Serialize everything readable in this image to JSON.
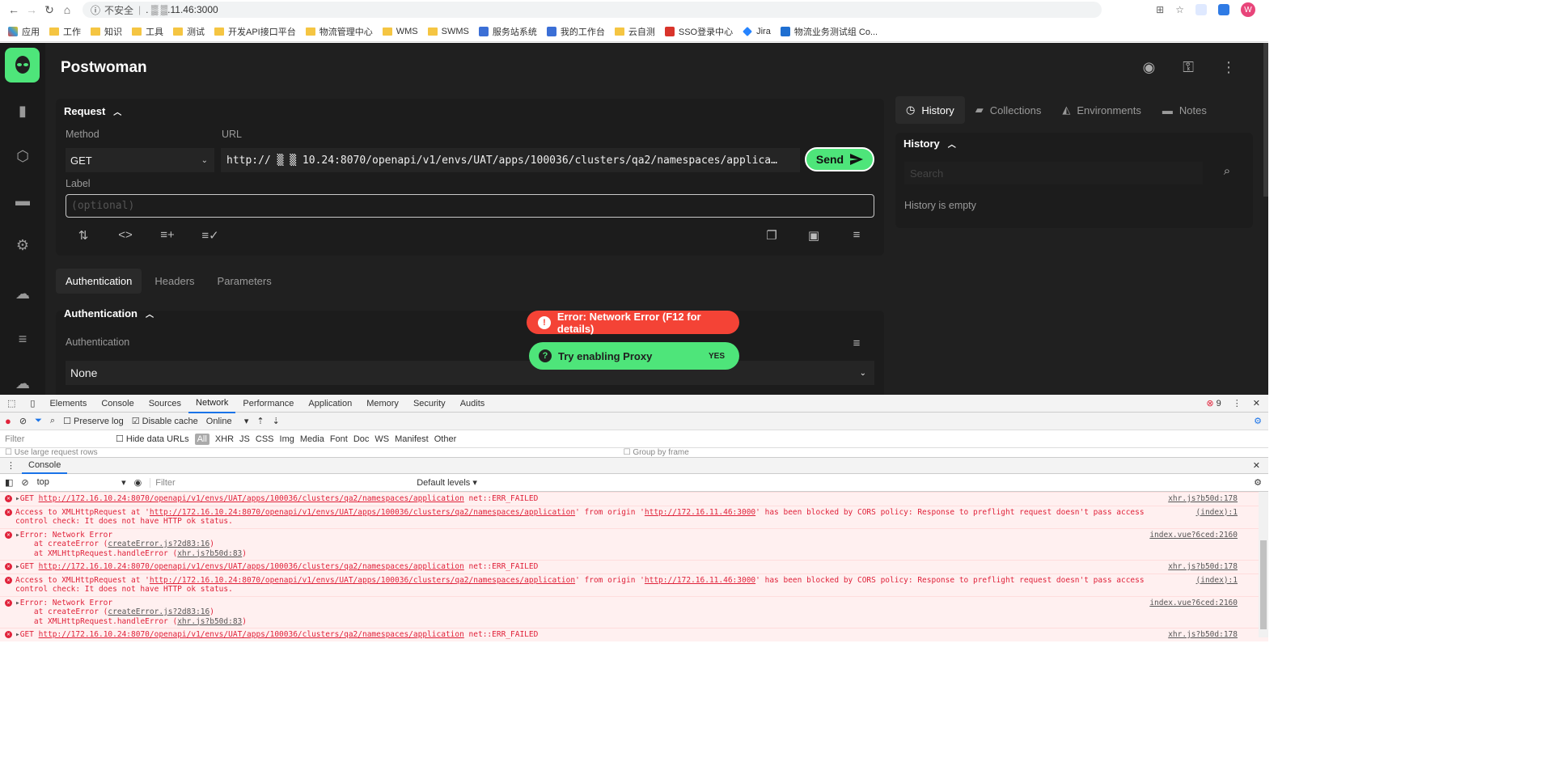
{
  "browser": {
    "insecure_label": "不安全",
    "address": ". ▒ ▒.11.46:3000",
    "avatar_letter": "W",
    "bookmarks": [
      "应用",
      "工作",
      "知识",
      "工具",
      "测试",
      "开发API接口平台",
      "物流管理中心",
      "WMS",
      "SWMS",
      "服务站系统",
      "我的工作台",
      "云自测",
      "SSO登录中心",
      "Jira",
      "物流业务测试组 Co..."
    ]
  },
  "app": {
    "brand": "Postwoman",
    "request": {
      "title": "Request",
      "method_label": "Method",
      "method_value": "GET",
      "url_label": "URL",
      "url_value": "http://  ▒ ▒ 10.24:8070/openapi/v1/envs/UAT/apps/100036/clusters/qa2/namespaces/applica…",
      "send_label": "Send",
      "label_label": "Label",
      "label_placeholder": "(optional)"
    },
    "tabs": [
      "Authentication",
      "Headers",
      "Parameters"
    ],
    "auth": {
      "title": "Authentication",
      "field_label": "Authentication",
      "value": "None"
    },
    "right_tabs": [
      "History",
      "Collections",
      "Environments",
      "Notes"
    ],
    "history": {
      "title": "History",
      "search_placeholder": "Search",
      "empty_text": "History is empty"
    },
    "toast_error": "Error: Network Error (F12 for details)",
    "toast_proxy": "Try enabling Proxy",
    "toast_proxy_action": "YES",
    "colors": {
      "accent": "#4ee57a",
      "error": "#f44336",
      "bg": "#202020"
    }
  },
  "devtools": {
    "tabs": [
      "Elements",
      "Console",
      "Sources",
      "Network",
      "Performance",
      "Application",
      "Memory",
      "Security",
      "Audits"
    ],
    "error_count": "9",
    "preserve_log": "Preserve log",
    "disable_cache": "Disable cache",
    "throttle": "Online",
    "filter_placeholder": "Filter",
    "hide_data_urls": "Hide data URLs",
    "filter_types": [
      "All",
      "XHR",
      "JS",
      "CSS",
      "Img",
      "Media",
      "Font",
      "Doc",
      "WS",
      "Manifest",
      "Other"
    ],
    "large_rows": "Use large request rows",
    "group_by_frame": "Group by frame",
    "drawer_tab": "Console",
    "context": "top",
    "console_filter": "Filter",
    "levels": "Default levels ▾",
    "logs": {
      "get_prefix": "GET ",
      "get_url": "http://172.16.10.24:8070/openapi/v1/envs/UAT/apps/100036/clusters/qa2/namespaces/application",
      "get_suffix": " net::ERR_FAILED",
      "get_src": "xhr.js?b50d:178",
      "cors_a": "Access to XMLHttpRequest at '",
      "cors_b": "' from origin '",
      "cors_origin": "http://172.16.11.46:3000",
      "cors_c": "' has been blocked by CORS policy: Response to preflight request doesn't pass access control check: It does not have HTTP ok status.",
      "cors_src": "(index):1",
      "err_title": "Error: Network Error",
      "at1_a": "at createError (",
      "at1_link": "createError.js?2d83:16",
      "at2_a": "at XMLHttpRequest.handleError (",
      "at2_link": "xhr.js?b50d:83",
      "close_paren": ")",
      "err_src": "index.vue?6ced:2160"
    }
  }
}
